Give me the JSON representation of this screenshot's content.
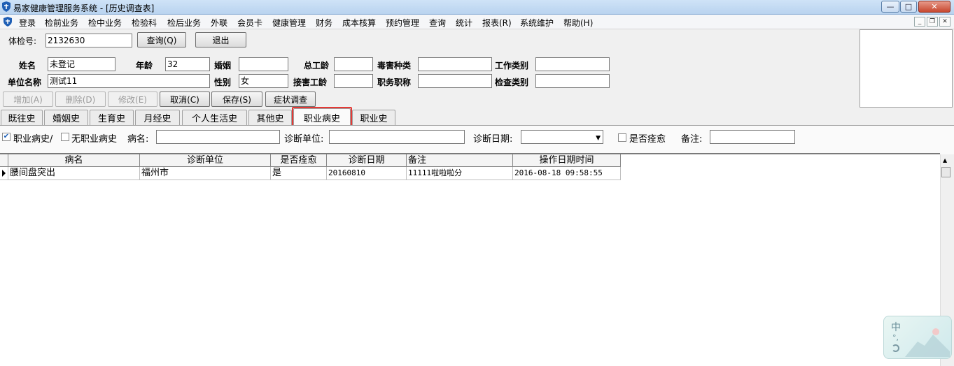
{
  "window": {
    "title": "易家健康管理服务系统 - [历史调查表]",
    "buttons": {
      "minimize": "—",
      "maximize": "□",
      "close": "✕"
    }
  },
  "menubar": {
    "items": [
      "登录",
      "检前业务",
      "检中业务",
      "检验科",
      "检后业务",
      "外联",
      "会员卡",
      "健康管理",
      "财务",
      "成本核算",
      "预约管理",
      "查询",
      "统计",
      "报表(R)",
      "系统维护",
      "帮助(H)"
    ],
    "mdi": {
      "minimize": "_",
      "restore": "❐",
      "close": "✕"
    }
  },
  "search": {
    "label": "体检号:",
    "value": "2132630",
    "query_button": "查询(Q)",
    "exit_button": "退出"
  },
  "person": {
    "name_label": "姓名",
    "name_value": "未登记",
    "age_label": "年龄",
    "age_value": "32",
    "marriage_label": "婚姻",
    "marriage_value": "",
    "total_seniority_label": "总工龄",
    "total_seniority_value": "",
    "hazard_type_label": "毒害种类",
    "hazard_type_value": "",
    "job_category_label": "工作类别",
    "job_category_value": "",
    "company_label": "单位名称",
    "company_value": "测试11",
    "sex_label": "性别",
    "sex_value": "女",
    "exposure_seniority_label": "接害工龄",
    "exposure_seniority_value": "",
    "title_label": "职务职称",
    "title_value": "",
    "check_category_label": "检查类别",
    "check_category_value": ""
  },
  "actions": {
    "add": "增加(A)",
    "delete": "删除(D)",
    "edit": "修改(E)",
    "cancel": "取消(C)",
    "save": "保存(S)",
    "symptom": "症状调查"
  },
  "tabs": [
    "既往史",
    "婚姻史",
    "生育史",
    "月经史",
    "个人生活史",
    "其他史",
    "职业病史",
    "职业史"
  ],
  "active_tab": "职业病史",
  "filters": {
    "has_history_label": "职业病史/",
    "has_history_checked": "✔",
    "no_history_label": "无职业病史",
    "disease_label": "病名:",
    "disease_value": "",
    "unit_label": "诊断单位:",
    "unit_value": "",
    "date_label": "诊断日期:",
    "date_value": "",
    "cured_label": "是否痊愈",
    "remark_label": "备注:",
    "remark_value": ""
  },
  "grid": {
    "columns": [
      "病名",
      "诊断单位",
      "是否痊愈",
      "诊断日期",
      "备注",
      "操作日期时间"
    ],
    "rows": [
      [
        "腰间盘突出",
        "福州市",
        "是",
        "20160810",
        "11111啦啦啦分",
        "2016-08-18 09:58:55"
      ]
    ]
  },
  "ime": {
    "label": "中",
    "symbols": "°,"
  }
}
